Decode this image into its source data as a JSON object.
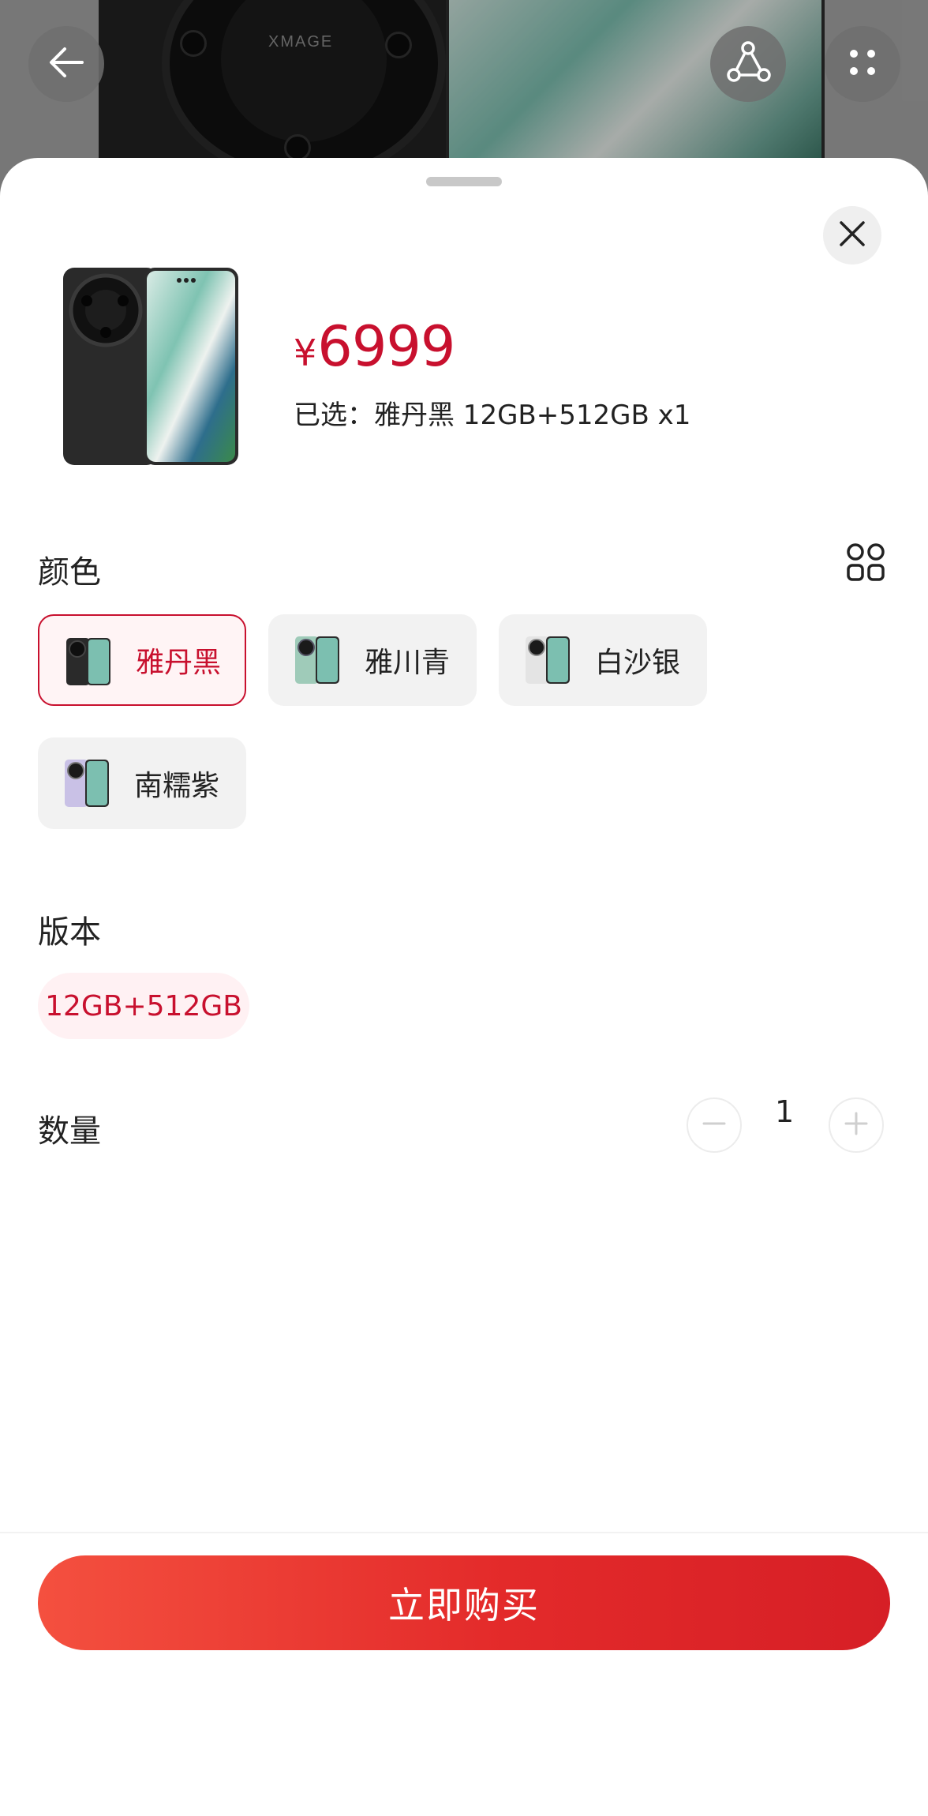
{
  "backdrop": {
    "logo_text": "XMAGE"
  },
  "top_bar": {
    "back_icon": "arrow-left-icon",
    "share_icon": "share-icon",
    "more_icon": "more-dots-icon"
  },
  "sheet": {
    "close_icon": "close-icon"
  },
  "product": {
    "currency": "¥",
    "price": "6999",
    "selected_text": "已选：雅丹黑 12GB+512GB x1"
  },
  "color_section": {
    "label": "颜色",
    "view_icon": "grid-view-icon",
    "options": [
      {
        "label": "雅丹黑",
        "selected": true
      },
      {
        "label": "雅川青",
        "selected": false
      },
      {
        "label": "白沙银",
        "selected": false
      },
      {
        "label": "南糯紫",
        "selected": false
      }
    ]
  },
  "version_section": {
    "label": "版本",
    "options": [
      {
        "label": "12GB+512GB",
        "selected": true
      }
    ]
  },
  "quantity_section": {
    "label": "数量",
    "value": "1",
    "minus_icon": "minus-icon",
    "plus_icon": "plus-icon"
  },
  "footer": {
    "buy_label": "立即购买"
  },
  "colors": {
    "accent": "#c8102e",
    "button_start": "#f4503f",
    "button_end": "#d61f26"
  }
}
